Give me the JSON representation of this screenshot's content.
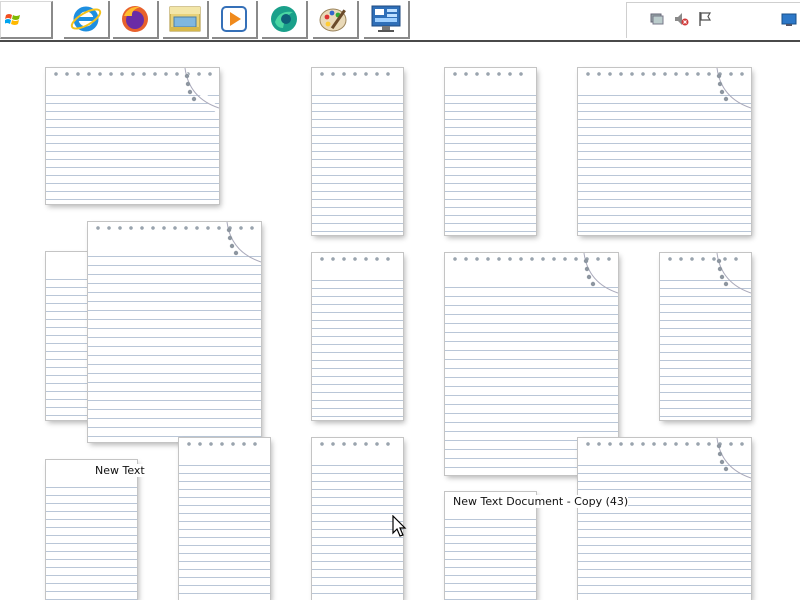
{
  "taskbar": {
    "quick_launch": [
      {
        "name": "internet-explorer-icon"
      },
      {
        "name": "firefox-icon"
      },
      {
        "name": "file-explorer-icon"
      },
      {
        "name": "media-player-icon"
      },
      {
        "name": "browser-globe-icon"
      },
      {
        "name": "paint-icon"
      },
      {
        "name": "control-panel-icon"
      }
    ],
    "tray_icons": [
      "network-icon",
      "volume-muted-icon",
      "action-center-flag-icon",
      "show-desktop-icon"
    ]
  },
  "desktop": {
    "labels": {
      "file_label_a": "New Text",
      "file_label_b": "New Text Document - Copy (43)"
    }
  },
  "colors": {
    "taskbar_border": "#4a4a4a",
    "paper_line": "#b9c6d7",
    "background": "#ffffff"
  }
}
